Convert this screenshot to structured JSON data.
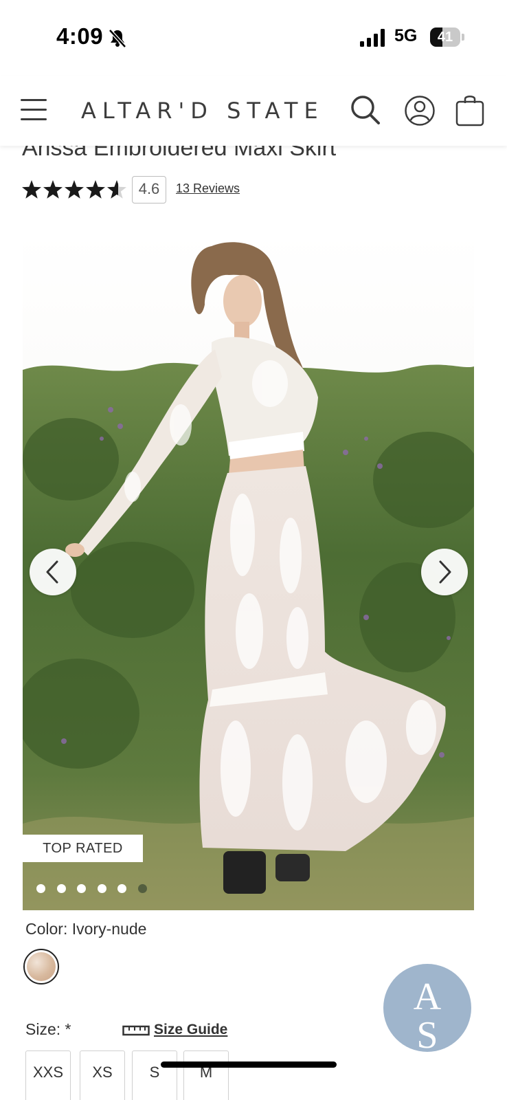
{
  "status_bar": {
    "time": "4:09",
    "network": "5G",
    "battery_level": "41",
    "battery_fraction": 0.41
  },
  "header": {
    "brand": "ALTAR'D STATE",
    "icons": [
      "menu-icon",
      "search-icon",
      "account-icon",
      "shopping-bag-icon"
    ]
  },
  "product": {
    "title": "Arissa Embroidered Maxi Skirt",
    "rating": {
      "value": "4.6",
      "stars_out_of_5": 4.6,
      "reviews_label": "13 Reviews"
    },
    "gallery": {
      "badge": "TOP RATED",
      "slide_count": 6,
      "current_slide": 1,
      "icons": [
        "chevron-left-icon",
        "chevron-right-icon"
      ]
    },
    "color": {
      "label": "Color: Ivory-nude",
      "swatch_color": "#d8b99e"
    },
    "size": {
      "label": "Size: *",
      "guide_label": "Size Guide",
      "options": [
        "XXS",
        "XS",
        "S",
        "M"
      ]
    }
  },
  "brand_badge": {
    "letters": "AS",
    "color": "#9fb5cc"
  }
}
